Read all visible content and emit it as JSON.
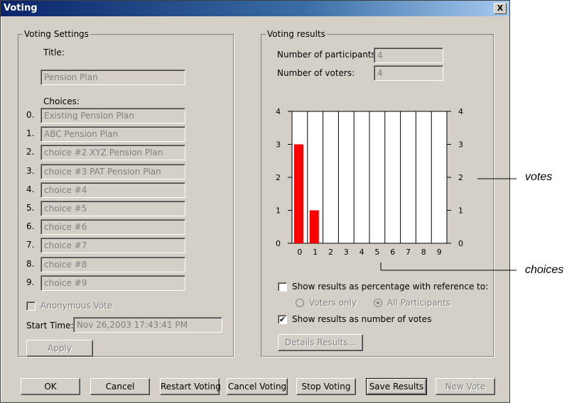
{
  "window": {
    "title": "Voting",
    "close_label": "X"
  },
  "settings": {
    "group_label": "Voting Settings",
    "title_label": "Title:",
    "title_value": "Pension Plan",
    "choices_label": "Choices:",
    "choices": [
      {
        "num": "0.",
        "value": "Existing Pension Plan"
      },
      {
        "num": "1.",
        "value": "ABC Pension Plan"
      },
      {
        "num": "2.",
        "value": "choice #2  XYZ Pension Plan"
      },
      {
        "num": "3.",
        "value": "choice #3 PAT Pension Plan"
      },
      {
        "num": "4.",
        "value": "choice #4"
      },
      {
        "num": "5.",
        "value": "choice #5"
      },
      {
        "num": "6.",
        "value": "choice #6"
      },
      {
        "num": "7.",
        "value": "choice #7"
      },
      {
        "num": "8.",
        "value": "choice #8"
      },
      {
        "num": "9.",
        "value": "choice #9"
      }
    ],
    "anonymous_label": "Anonymous Vote",
    "start_time_label": "Start Time:",
    "start_time_value": "Nov 26,2003  17:43:41 PM",
    "apply_label": "Apply"
  },
  "results": {
    "group_label": "Voting results",
    "participants_label": "Number of participants:",
    "participants_value": "4",
    "voters_label": "Number of voters:",
    "voters_value": "4",
    "pct_label": "Show results as percentage with reference to:",
    "radio_voters": "Voters only",
    "radio_all": "All Participants",
    "number_label": "Show results as number of votes",
    "number_checked": "✔",
    "details_label": "Details Results..."
  },
  "buttons": {
    "ok": "OK",
    "cancel": "Cancel",
    "restart": "Restart Voting",
    "cancel_voting": "Cancel Voting",
    "stop": "Stop Voting",
    "save": "Save Results",
    "new_vote": "New Vote"
  },
  "annotations": {
    "votes": "votes",
    "choices": "choices"
  },
  "colors": {
    "bar": "#ff0000",
    "face": "#d4d0c8",
    "title_start": "#0a246a"
  },
  "chart_data": {
    "type": "bar",
    "categories": [
      "0",
      "1",
      "2",
      "3",
      "4",
      "5",
      "6",
      "7",
      "8",
      "9"
    ],
    "values": [
      3,
      1,
      0,
      0,
      0,
      0,
      0,
      0,
      0,
      0
    ],
    "yticks": [
      "0",
      "1",
      "2",
      "3",
      "4"
    ],
    "ylim": [
      0,
      4
    ],
    "grid": true
  }
}
